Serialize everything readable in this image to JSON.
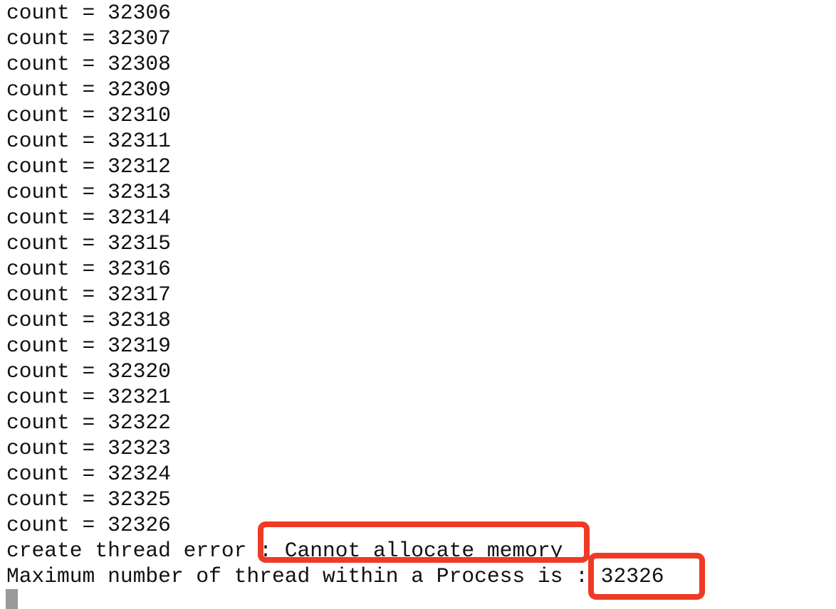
{
  "terminal": {
    "lines": [
      "count = 32306",
      "count = 32307",
      "count = 32308",
      "count = 32309",
      "count = 32310",
      "count = 32311",
      "count = 32312",
      "count = 32313",
      "count = 32314",
      "count = 32315",
      "count = 32316",
      "count = 32317",
      "count = 32318",
      "count = 32319",
      "count = 32320",
      "count = 32321",
      "count = 32322",
      "count = 32323",
      "count = 32324",
      "count = 32325",
      "count = 32326",
      "create thread error : Cannot allocate memory",
      "Maximum number of thread within a Process is : 32326"
    ],
    "highlight_color": "#ef3a25",
    "cursor_color": "#9a9a9a"
  }
}
